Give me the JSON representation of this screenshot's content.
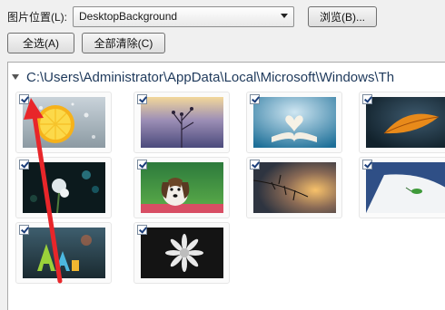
{
  "toolbar": {
    "location_label": "图片位置(L):",
    "location_value": "DesktopBackground",
    "browse_label": "浏览(B)...",
    "select_all_label": "全选(A)",
    "clear_all_label": "全部清除(C)"
  },
  "folder": {
    "path": "C:\\Users\\Administrator\\AppData\\Local\\Microsoft\\Windows\\Th"
  },
  "thumbnails": [
    {
      "name": "lemon-slice-water",
      "checked": true
    },
    {
      "name": "purple-dusk-plant",
      "checked": true
    },
    {
      "name": "open-book-heart",
      "checked": true
    },
    {
      "name": "orange-leaf-macro",
      "checked": true
    },
    {
      "name": "night-floral-bokeh",
      "checked": true
    },
    {
      "name": "puppy-on-grass",
      "checked": true
    },
    {
      "name": "branch-at-sunset",
      "checked": true
    },
    {
      "name": "green-bug-on-white",
      "checked": true
    },
    {
      "name": "colorful-letters-aa",
      "checked": true
    },
    {
      "name": "white-daisy-dark",
      "checked": true
    }
  ],
  "annotation": {
    "color": "#e8262a"
  }
}
